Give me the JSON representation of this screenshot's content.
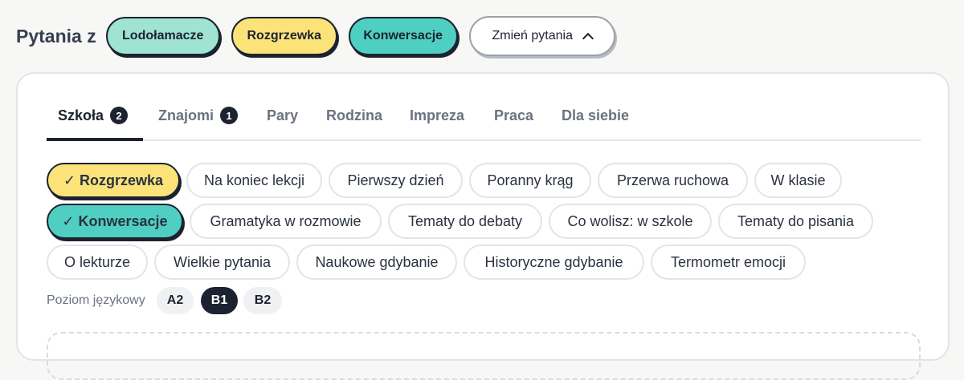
{
  "header": {
    "label": "Pytania z",
    "categories": [
      "Lodołamacze",
      "Rozgrzewka",
      "Konwersacje"
    ],
    "change_button": "Zmień pytania"
  },
  "tabs": [
    {
      "label": "Szkoła",
      "badge": "2",
      "active": true
    },
    {
      "label": "Znajomi",
      "badge": "1",
      "active": false
    },
    {
      "label": "Pary"
    },
    {
      "label": "Rodzina"
    },
    {
      "label": "Impreza"
    },
    {
      "label": "Praca"
    },
    {
      "label": "Dla siebie"
    }
  ],
  "chips": {
    "row1": [
      "✓ Rozgrzewka",
      "Na koniec lekcji",
      "Pierwszy dzień",
      "Poranny krąg",
      "Przerwa ruchowa",
      "W klasie"
    ],
    "row2": [
      "✓ Konwersacje",
      "Gramatyka w rozmowie",
      "Tematy do debaty",
      "Co wolisz: w szkole",
      "Tematy do pisania"
    ],
    "row3": [
      "O lekturze",
      "Wielkie pytania",
      "Naukowe gdybanie",
      "Historyczne gdybanie",
      "Termometr emocji"
    ]
  },
  "level": {
    "label": "Poziom językowy",
    "options": [
      "A2",
      "B1",
      "B2"
    ],
    "selected": "B1"
  },
  "colors": {
    "ink": "#1c2230",
    "icebreaker": "#9fe3d3",
    "warmup": "#fbe37a",
    "conversation": "#4fcfc2"
  }
}
